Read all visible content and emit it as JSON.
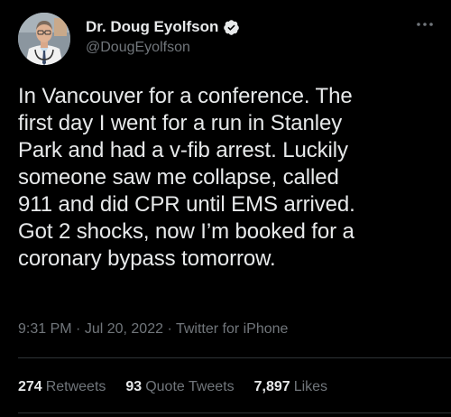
{
  "author": {
    "display_name": "Dr. Doug Eyolfson",
    "handle": "@DougEyolfson",
    "verified": true
  },
  "tweet": {
    "lines": [
      "In Vancouver for a conference. The",
      "first day I went for a run in Stanley",
      "Park and had a v-fib arrest. Luckily",
      "someone saw me collapse, called",
      "911 and did CPR until EMS arrived.",
      "Got 2 shocks, now I’m booked for a",
      "coronary bypass tomorrow."
    ]
  },
  "meta": {
    "time": "9:31 PM",
    "separator": " · ",
    "date": "Jul 20, 2022",
    "source": "Twitter for iPhone"
  },
  "stats": {
    "retweets_count": "274",
    "retweets_label": "Retweets",
    "quotes_count": "93",
    "quotes_label": "Quote Tweets",
    "likes_count": "7,897",
    "likes_label": "Likes"
  },
  "icons": {
    "verified": "verified-badge-icon",
    "more": "more-options-icon"
  },
  "colors": {
    "background": "#000000",
    "text_primary": "#e7e9ea",
    "text_secondary": "#71767b",
    "divider": "#2f3336",
    "verified_badge": "#e7e9ea"
  }
}
